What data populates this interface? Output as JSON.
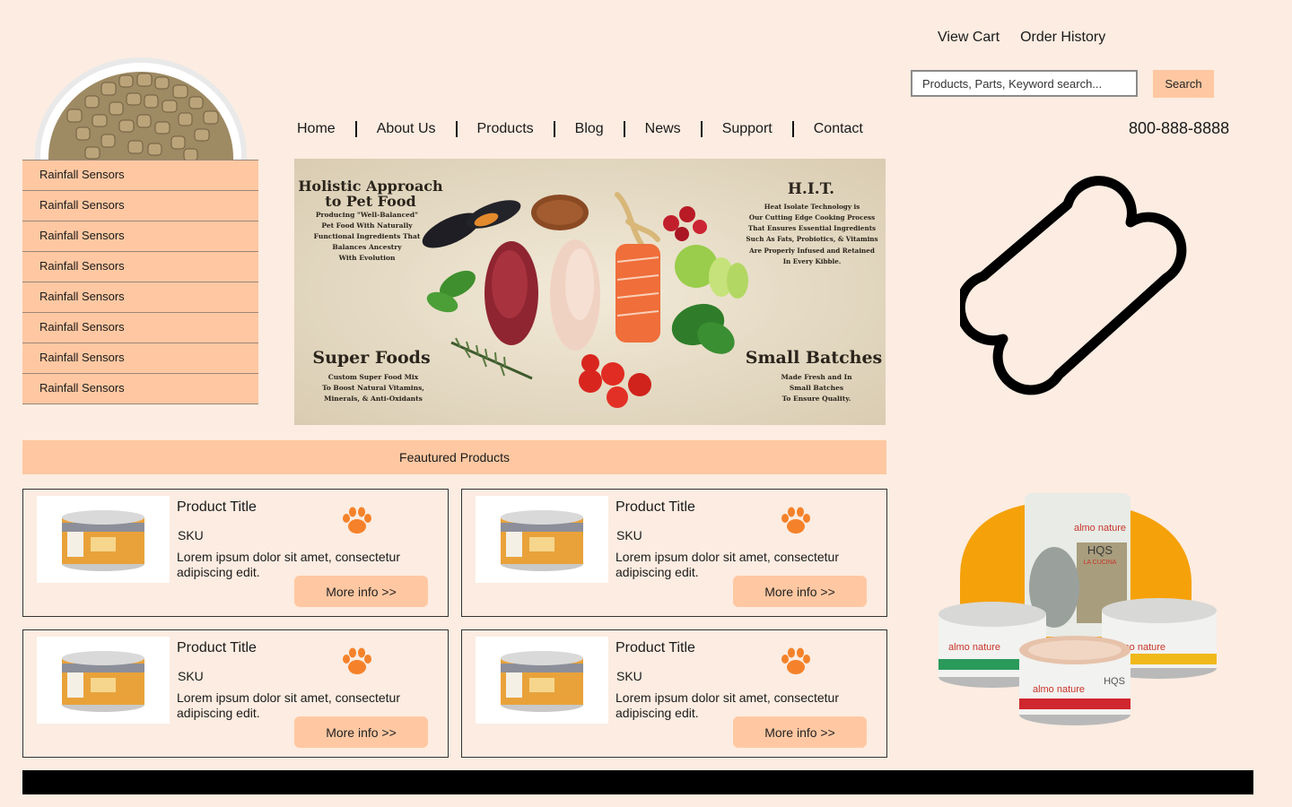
{
  "top_links": {
    "view_cart": "View Cart",
    "order_history": "Order History"
  },
  "search": {
    "placeholder": "Products, Parts, Keyword search...",
    "button_label": "Search"
  },
  "nav": [
    "Home",
    "About Us",
    "Products",
    "Blog",
    "News",
    "Support",
    "Contact"
  ],
  "phone": "800-888-8888",
  "sidebar": {
    "items": [
      "Rainfall Sensors",
      "Rainfall Sensors",
      "Rainfall Sensors",
      "Rainfall Sensors",
      "Rainfall Sensors",
      "Rainfall Sensors",
      "Rainfall Sensors",
      "Rainfall Sensors"
    ]
  },
  "banner": {
    "heading_1": "Holistic Approach",
    "heading_1b": "to Pet Food",
    "text_1": [
      "Producing \"Well-Balanced\"",
      "Pet Food With Naturally",
      "Functional Ingredients That",
      "Balances Ancestry",
      "With Evolution"
    ],
    "heading_2": "H.I.T.",
    "text_2": [
      "Heat Isolate Technology is",
      "Our Cutting Edge Cooking Process",
      "That Ensures Essential Ingredients",
      "Such As Fats, Probiotics, & Vitamins",
      "Are Properly Infused and Retained",
      "In Every Kibble."
    ],
    "heading_3": "Super Foods",
    "text_3": [
      "Custom Super Food Mix",
      "To Boost Natural Vitamins,",
      "Minerals, & Anti-Oxidants"
    ],
    "heading_4": "Small Batches",
    "text_4": [
      "Made Fresh and In",
      "Small Batches",
      "To Ensure Quality."
    ]
  },
  "featured": {
    "title": "Feautured Products"
  },
  "products": [
    {
      "title": "Product Title",
      "sku": "SKU",
      "description": "Lorem ipsum dolor sit amet, consectetur adipiscing edit.",
      "more_label": "More info >>"
    },
    {
      "title": "Product Title",
      "sku": "SKU",
      "description": "Lorem ipsum dolor sit amet, consectetur adipiscing edit.",
      "more_label": "More info >>"
    },
    {
      "title": "Product Title",
      "sku": "SKU",
      "description": "Lorem ipsum dolor sit amet, consectetur adipiscing edit.",
      "more_label": "More info >>"
    },
    {
      "title": "Product Title",
      "sku": "SKU",
      "description": "Lorem ipsum dolor sit amet, consectetur adipiscing edit.",
      "more_label": "More info >>"
    }
  ],
  "promo": {
    "brand": "almo nature",
    "line": "HQS",
    "subline": "LA CUCINA"
  },
  "colors": {
    "background": "#fcece1",
    "accent": "#ffc8a2",
    "paw": "#f5822a",
    "footer": "#000000"
  },
  "icons": {
    "bone": "bone-icon",
    "paw": "paw-icon"
  }
}
